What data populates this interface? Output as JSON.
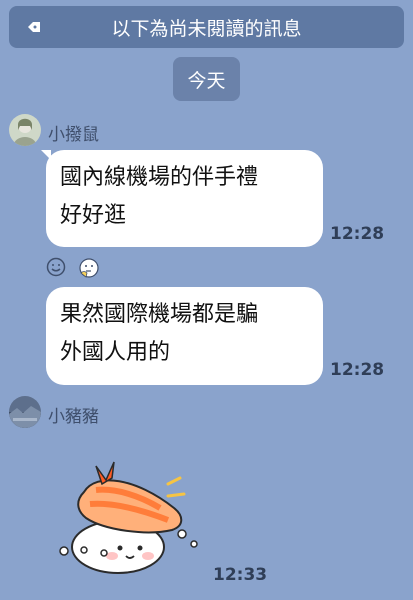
{
  "banner": {
    "text": "以下為尚未閱讀的訊息",
    "back_icon": "back-arrow-icon"
  },
  "date_separator": "今天",
  "messages": [
    {
      "sender": "小撥鼠",
      "avatar_icon": "avatar-icon",
      "bubbles": [
        {
          "text": "國內線機場的伴手禮好好逛",
          "line1": "國內線機場的伴手禮",
          "line2": "好好逛",
          "time": "12:28",
          "reactions": [
            "smile-reaction-icon",
            "thinking-reaction-icon"
          ]
        },
        {
          "text": "果然國際機場都是騙外國人用的",
          "line1": "果然國際機場都是騙",
          "line2": "外國人用的",
          "time": "12:28"
        }
      ]
    },
    {
      "sender": "小豬豬",
      "avatar_icon": "avatar-icon",
      "sticker": {
        "name": "shrimp-sushi-sticker",
        "time": "12:33"
      }
    }
  ],
  "colors": {
    "background": "#8aa3cc",
    "banner": "#5f79a3",
    "bubble": "#ffffff",
    "accent_shrimp": "#f08a4b"
  }
}
